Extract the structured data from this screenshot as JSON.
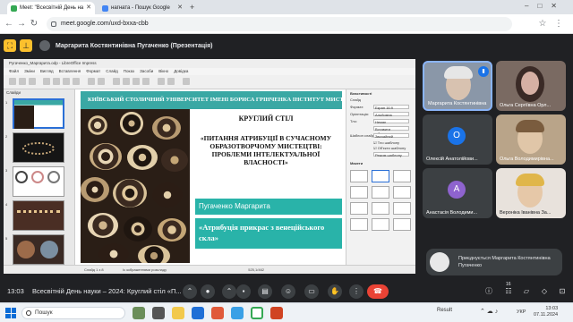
{
  "browser": {
    "tabs": [
      {
        "title": "Meet: \"Всесвітній День на",
        "favicon_color": "#34a853",
        "active": true
      },
      {
        "title": "нагната - Пошук Google",
        "favicon_color": "#4285f4",
        "active": false
      }
    ],
    "new_tab_label": "+",
    "url": "meet.google.com/uxd-bxxa-cbb"
  },
  "presentation": {
    "presenter_title": "Маргарита Костянтинівна Пугаченко (Презентація)"
  },
  "impress": {
    "app_title": "Pугаченко_Маргарита.odp - LibreOffice Impress",
    "menu": [
      "Файл",
      "Зміни",
      "Вигляд",
      "Вставлення",
      "Формат",
      "Слайд",
      "Показ",
      "Засоби",
      "Вікно",
      "Довідка"
    ],
    "slides_panel_title": "Слайди",
    "slide_numbers": [
      "1",
      "2",
      "3",
      "4",
      "5",
      "6"
    ],
    "properties_title": "Властивості",
    "props_section": "Слайд",
    "props_rows": [
      {
        "label": "Формат:",
        "value": "Екран 16:9"
      },
      {
        "label": "Орієнтація:",
        "value": "Альбомна"
      },
      {
        "label": "Тло:",
        "value": "Немає"
      },
      {
        "label": "",
        "value": "Вставити зображення"
      },
      {
        "label": "Шаблон слайда:",
        "value": "Звичайний"
      },
      {
        "label": "",
        "value": "Тло шаблону"
      },
      {
        "label": "",
        "value": "Об'єкти шаблону"
      },
      {
        "label": "",
        "value": "Режим шаблону"
      }
    ],
    "layouts_title": "Макети",
    "status_left": "Слайд 1 з 8",
    "status_mid": "Із зображеннями розкладу",
    "status_right": "525,1/462",
    "slide": {
      "header": "КИЇВСЬКИЙ СТОЛИЧНИЙ УНІВЕРСИТЕТ ІМЕНІ БОРИСА ГРІНЧЕНКА ІНСТИТУТ МИСТЕЦТВ",
      "round_table": "КРУГЛИЙ СТІЛ",
      "topic": "«ПИТАННЯ АТРИБУЦІЇ В СУЧАСНОМУ ОБРАЗОТВОРЧОМУ МИСТЕЦТВІ: ПРОБЛЕМИ ІНТЕЛЕКТУАЛЬНОЇ ВЛАСНОСТІ»",
      "author": "Пугаченко Маргарита",
      "talk_title": "«Атрибуція прикрас з венеційського скла»"
    }
  },
  "participants": [
    {
      "name": "Маргарита Костянтинівна",
      "type": "video",
      "avatar_color": "#6b7a8f",
      "speaking": true
    },
    {
      "name": "Ольга Сергіївна Орл...",
      "type": "video",
      "avatar_color": "#c9a6a3",
      "speaking": false
    },
    {
      "name": "Олексій Анатолійови...",
      "type": "avatar",
      "initial": "О",
      "avatar_color": "#1a73e8"
    },
    {
      "name": "Ольга Володимирівна...",
      "type": "video",
      "avatar_color": "#b9a489",
      "speaking": false
    },
    {
      "name": "Анастасія Володими...",
      "type": "avatar",
      "initial": "А",
      "avatar_color": "#8e63ce"
    },
    {
      "name": "Вероніка Іванівна За...",
      "type": "video",
      "avatar_color": "#d9c3a6",
      "speaking": false
    }
  ],
  "join_notice": "Приєднується Маргарита Костянтинівна Пугаченко",
  "meet_controls": {
    "time": "13:03",
    "meeting_name": "Всесвітній День науки – 2024: Круглий стіл «П...",
    "participant_count": "16"
  },
  "taskbar": {
    "search_placeholder": "Пошук",
    "weather": "Result",
    "lang": "УКР",
    "time": "13:03",
    "date": "07.11.2024"
  },
  "colors": {
    "accent_teal": "#29b3a9",
    "meet_bg": "#202124",
    "end_call": "#ea4335",
    "presenter_button": "#fbc02d"
  }
}
